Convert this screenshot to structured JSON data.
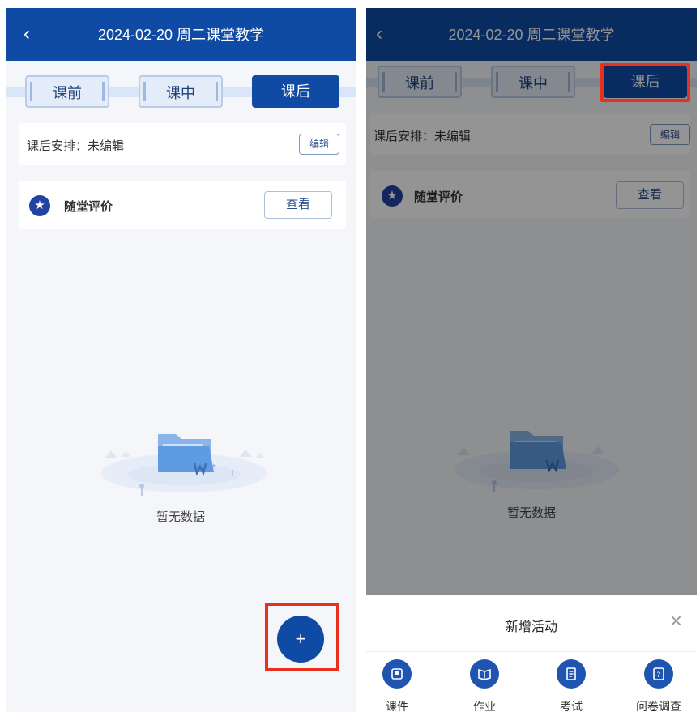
{
  "header": {
    "back_glyph": "‹",
    "title": "2024-02-20 周二课堂教学"
  },
  "tabs": [
    {
      "label": "课前",
      "state": "inactive"
    },
    {
      "label": "课中",
      "state": "inactive"
    },
    {
      "label": "课后",
      "state": "active"
    }
  ],
  "arrangement": {
    "label": "课后安排：未编辑",
    "edit_label": "编辑"
  },
  "evaluation": {
    "icon": "star-icon",
    "title": "随堂评价",
    "view_label": "查看"
  },
  "empty": {
    "text": "暂无数据"
  },
  "fab": {
    "glyph": "+"
  },
  "sheet": {
    "title": "新增活动",
    "close_glyph": "×",
    "items": [
      {
        "label": "课件",
        "icon": "courseware-icon"
      },
      {
        "label": "作业",
        "icon": "homework-icon"
      },
      {
        "label": "考试",
        "icon": "exam-icon"
      },
      {
        "label": "问卷调查",
        "icon": "survey-icon"
      }
    ]
  },
  "colors": {
    "brand": "#0f4aa5",
    "highlight": "#e8301f",
    "background": "#f5f6fa"
  }
}
